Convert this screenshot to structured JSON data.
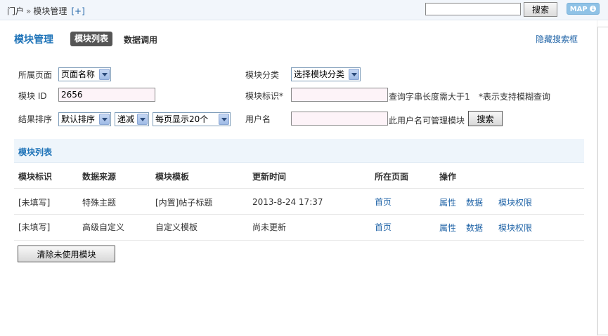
{
  "topbar": {
    "breadcrumb": [
      "门户",
      "模块管理"
    ],
    "separator": "»",
    "plus": "[+]",
    "search_value": "",
    "search_button": "搜索",
    "map_button": "MAP"
  },
  "header": {
    "title": "模块管理",
    "tabs": [
      {
        "label": "模块列表",
        "active": true
      },
      {
        "label": "数据调用",
        "active": false
      }
    ],
    "hide_search": "隐藏搜索框"
  },
  "form": {
    "page_label": "所属页面",
    "page_value": "页面名称",
    "category_label": "模块分类",
    "category_value": "选择模块分类",
    "id_label": "模块 ID",
    "id_value": "2656",
    "ident_label": "模块标识*",
    "ident_value": "",
    "ident_hint": "查询字串长度需大于1",
    "fuzzy_hint": "*表示支持模糊查询",
    "sort_label": "结果排序",
    "sort_value": "默认排序",
    "order_value": "递减",
    "perpage_value": "每页显示20个",
    "user_label": "用户名",
    "user_value": "",
    "user_hint": "此用户名可管理模块",
    "search_button": "搜索"
  },
  "list": {
    "title": "模块列表",
    "columns": [
      "模块标识",
      "数据来源",
      "模块模板",
      "更新时间",
      "所在页面",
      "操作"
    ],
    "rows": [
      {
        "ident": "[未填写]",
        "source": "特殊主题",
        "template": "[内置]帖子标题",
        "updated": "2013-8-24 17:37",
        "page": "首页",
        "actions": [
          "属性",
          "数据",
          "模块权限"
        ]
      },
      {
        "ident": "[未填写]",
        "source": "高级自定义",
        "template": "自定义模板",
        "updated": "尚未更新",
        "page": "首页",
        "actions": [
          "属性",
          "数据",
          "模块权限"
        ]
      }
    ],
    "clear_button": "清除未使用模块"
  }
}
